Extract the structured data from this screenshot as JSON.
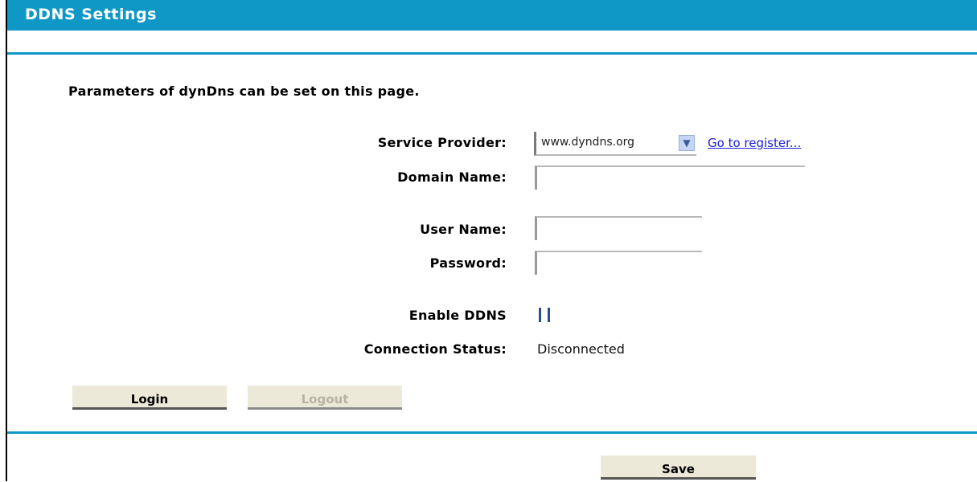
{
  "header": {
    "title": "DDNS Settings"
  },
  "intro_text": "Parameters of dynDns can be set on this page.",
  "form": {
    "service_provider": {
      "label": "Service Provider:",
      "selected": "www.dyndns.org",
      "link": "Go to register..."
    },
    "domain_name": {
      "label": "Domain Name:",
      "value": ""
    },
    "user_name": {
      "label": "User Name:",
      "value": ""
    },
    "password": {
      "label": "Password:",
      "value": ""
    },
    "enable_ddns": {
      "label": "Enable DDNS",
      "checked": false
    },
    "connection_status": {
      "label": "Connection Status:",
      "value": "Disconnected"
    }
  },
  "buttons": {
    "login": "Login",
    "logout": "Logout",
    "save": "Save"
  },
  "colors": {
    "accent": "#0f98c6",
    "button_bg": "#ece9d8",
    "link": "#1d1dd6"
  }
}
